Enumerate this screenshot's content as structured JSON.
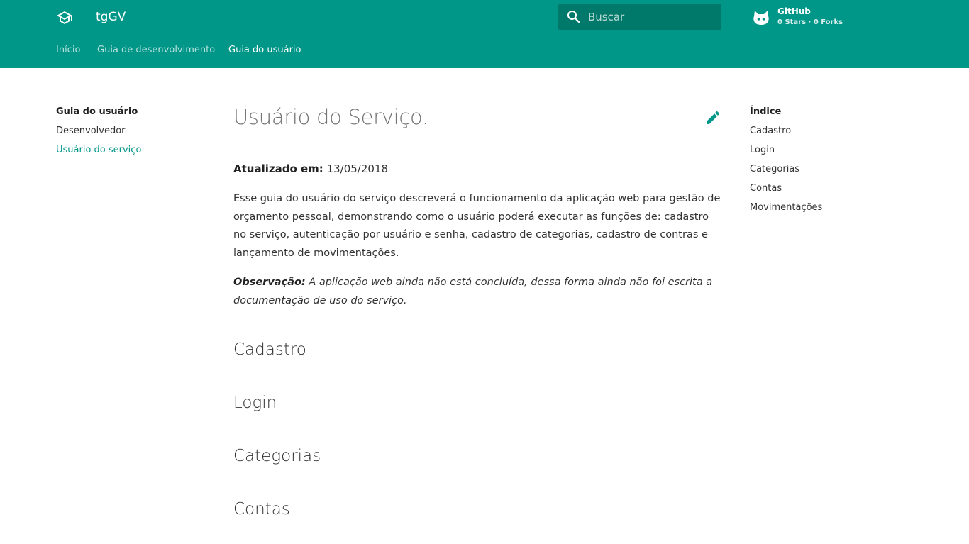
{
  "header": {
    "site_title": "tgGV",
    "search_placeholder": "Buscar",
    "repo": {
      "name": "GitHub",
      "stats": "0 Stars · 0 Forks"
    },
    "tabs": [
      {
        "label": "Início",
        "active": false
      },
      {
        "label": "Guia de desenvolvimento",
        "active": false
      },
      {
        "label": "Guia do usuário",
        "active": true
      }
    ]
  },
  "nav": {
    "title": "Guia do usuário",
    "items": [
      {
        "label": "Desenvolvedor",
        "active": false
      },
      {
        "label": "Usuário do serviço",
        "active": true
      }
    ]
  },
  "toc": {
    "title": "Índice",
    "items": [
      "Cadastro",
      "Login",
      "Categorias",
      "Contas",
      "Movimentações"
    ]
  },
  "content": {
    "title": "Usuário do Serviço.",
    "updated_label": "Atualizado em:",
    "updated_value": "13/05/2018",
    "intro": "Esse guia do usuário do serviço descreverá o funcionamento da aplicação web para gestão de orçamento pessoal, demonstrando como o usuário poderá executar as funções de: cadastro no serviço, autenticação por usuário e senha, cadastro de categorias, cadastro de contras e lançamento de movimentações.",
    "note_label": "Observação:",
    "note_text": "A aplicação web ainda não está concluída, dessa forma ainda não foi escrita a documentação de uso do serviço.",
    "sections": [
      "Cadastro",
      "Login",
      "Categorias",
      "Contas"
    ]
  },
  "colors": {
    "primary": "#009688",
    "primary_dark": "#00796b"
  },
  "icons": {
    "logo": "school-icon",
    "search": "search-icon",
    "repo": "github-icon",
    "edit": "pencil-icon"
  }
}
